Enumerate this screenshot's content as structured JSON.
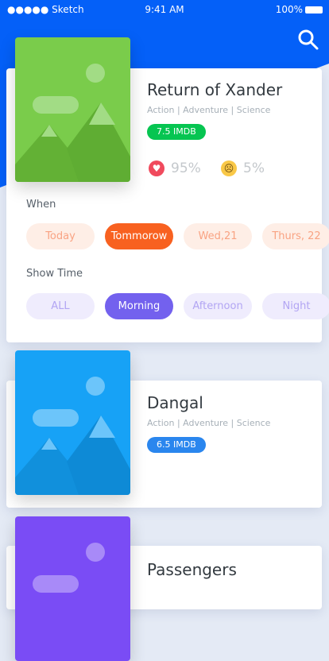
{
  "status": {
    "carrier": "●●●●● Sketch",
    "time": "9:41 AM",
    "battery": "100%"
  },
  "movies": [
    {
      "title": "Return of Xander",
      "genres": "Action | Adventure | Science",
      "rating": "7.5 IMDB",
      "badge_color": "#06c551",
      "poster_color": "#7acc4b",
      "likes": "95%",
      "dislikes": "5%"
    },
    {
      "title": "Dangal",
      "genres": "Action | Adventure | Science",
      "rating": "6.5 IMDB",
      "badge_color": "#2a86ee",
      "poster_color": "#17a2f6"
    },
    {
      "title": "Passengers",
      "poster_color": "#7a4cf5"
    }
  ],
  "when": {
    "label": "When",
    "options": [
      "Today",
      "Tommorow",
      "Wed,21",
      "Thurs, 22"
    ],
    "selected": "Tommorow"
  },
  "showtime": {
    "label": "Show Time",
    "options": [
      "ALL",
      "Morning",
      "Afternoon",
      "Night"
    ],
    "selected": "Morning"
  }
}
